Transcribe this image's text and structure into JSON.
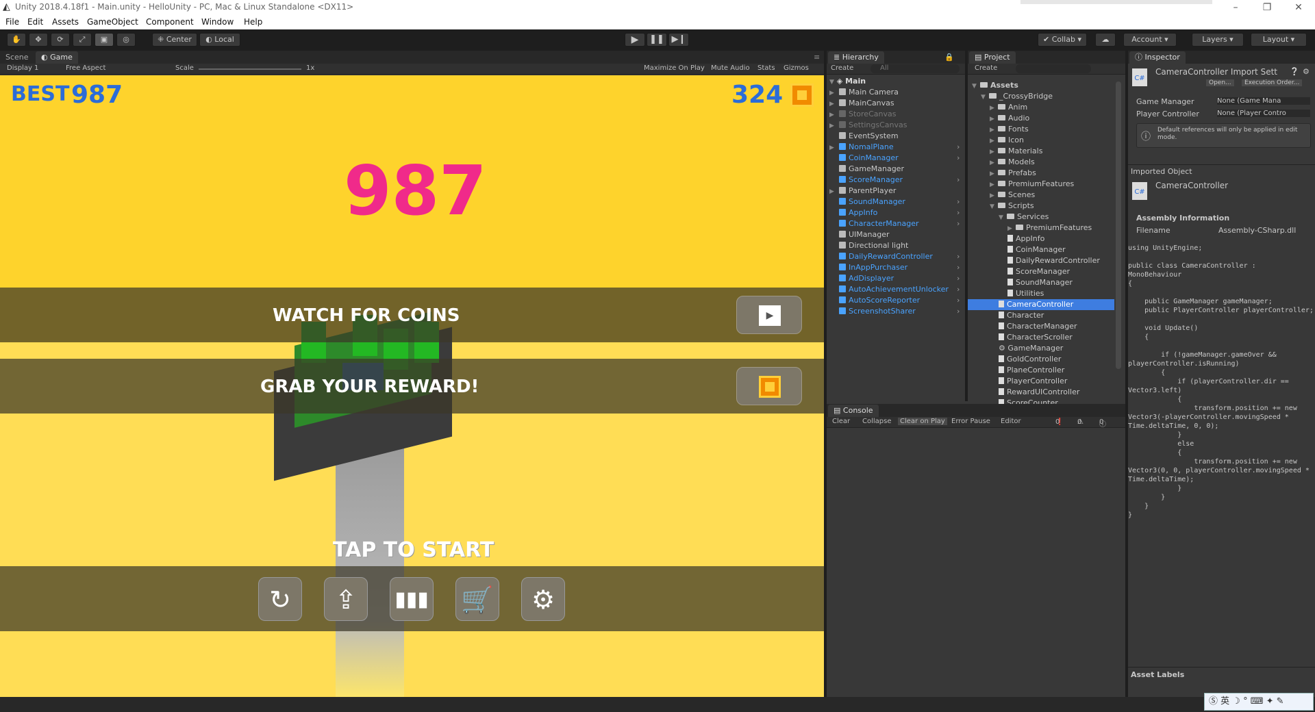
{
  "window": {
    "title": "Unity 2018.4.18f1 - Main.unity - HelloUnity - PC, Mac & Linux Standalone <DX11>",
    "minimize": "–",
    "maximize": "❐",
    "close": "✕"
  },
  "menu": [
    "File",
    "Edit",
    "Assets",
    "GameObject",
    "Component",
    "Window",
    "Help"
  ],
  "toolbar": {
    "center": "Center",
    "local": "Local",
    "collab": "Collab",
    "account": "Account",
    "layers": "Layers",
    "layout": "Layout"
  },
  "scene_tabs": {
    "scene": "Scene",
    "game": "Game"
  },
  "game_bar": {
    "display": "Display 1",
    "aspect": "Free Aspect",
    "scale": "Scale",
    "scale_val": "1x",
    "maximize": "Maximize On Play",
    "mute": "Mute Audio",
    "stats": "Stats",
    "gizmos": "Gizmos"
  },
  "game": {
    "best_label": "BEST",
    "best_value": "987",
    "coins": "324",
    "score": "987",
    "watch": "WATCH FOR COINS",
    "grab": "GRAB YOUR REWARD!",
    "tap": "TAP TO START"
  },
  "hierarchy": {
    "title": "Hierarchy",
    "create": "Create",
    "search": "All",
    "scene": "Main",
    "items": [
      {
        "name": "Main Camera",
        "color": "w",
        "arrow": true
      },
      {
        "name": "MainCanvas",
        "color": "w",
        "arrow": true
      },
      {
        "name": "StoreCanvas",
        "color": "d",
        "arrow": true
      },
      {
        "name": "SettingsCanvas",
        "color": "d",
        "arrow": true
      },
      {
        "name": "EventSystem",
        "color": "w",
        "arrow": false
      },
      {
        "name": "NomalPlane",
        "color": "b",
        "arrow": true
      },
      {
        "name": "CoinManager",
        "color": "b",
        "arrow": false
      },
      {
        "name": "GameManager",
        "color": "w",
        "arrow": false
      },
      {
        "name": "ScoreManager",
        "color": "b",
        "arrow": false
      },
      {
        "name": "ParentPlayer",
        "color": "w",
        "arrow": true
      },
      {
        "name": "SoundManager",
        "color": "b",
        "arrow": false
      },
      {
        "name": "AppInfo",
        "color": "b",
        "arrow": false
      },
      {
        "name": "CharacterManager",
        "color": "b",
        "arrow": false
      },
      {
        "name": "UIManager",
        "color": "w",
        "arrow": false
      },
      {
        "name": "Directional light",
        "color": "w",
        "arrow": false
      },
      {
        "name": "DailyRewardController",
        "color": "b",
        "arrow": false
      },
      {
        "name": "InAppPurchaser",
        "color": "b",
        "arrow": false
      },
      {
        "name": "AdDisplayer",
        "color": "b",
        "arrow": false
      },
      {
        "name": "AutoAchievementUnlocker",
        "color": "b",
        "arrow": false
      },
      {
        "name": "AutoScoreReporter",
        "color": "b",
        "arrow": false
      },
      {
        "name": "ScreenshotSharer",
        "color": "b",
        "arrow": false
      }
    ]
  },
  "project": {
    "title": "Project",
    "create": "Create",
    "items": [
      {
        "name": "Assets",
        "indent": 0,
        "type": "folder",
        "open": true,
        "bold": true
      },
      {
        "name": "_CrossyBridge",
        "indent": 1,
        "type": "folder",
        "open": true
      },
      {
        "name": "Anim",
        "indent": 2,
        "type": "folder"
      },
      {
        "name": "Audio",
        "indent": 2,
        "type": "folder"
      },
      {
        "name": "Fonts",
        "indent": 2,
        "type": "folder"
      },
      {
        "name": "Icon",
        "indent": 2,
        "type": "folder"
      },
      {
        "name": "Materials",
        "indent": 2,
        "type": "folder"
      },
      {
        "name": "Models",
        "indent": 2,
        "type": "folder"
      },
      {
        "name": "Prefabs",
        "indent": 2,
        "type": "folder"
      },
      {
        "name": "PremiumFeatures",
        "indent": 2,
        "type": "folder"
      },
      {
        "name": "Scenes",
        "indent": 2,
        "type": "folder"
      },
      {
        "name": "Scripts",
        "indent": 2,
        "type": "folder",
        "open": true
      },
      {
        "name": "Services",
        "indent": 3,
        "type": "folder",
        "open": true
      },
      {
        "name": "PremiumFeatures",
        "indent": 4,
        "type": "folder"
      },
      {
        "name": "AppInfo",
        "indent": 4,
        "type": "file"
      },
      {
        "name": "CoinManager",
        "indent": 4,
        "type": "file"
      },
      {
        "name": "DailyRewardController",
        "indent": 4,
        "type": "file"
      },
      {
        "name": "ScoreManager",
        "indent": 4,
        "type": "file"
      },
      {
        "name": "SoundManager",
        "indent": 4,
        "type": "file"
      },
      {
        "name": "Utilities",
        "indent": 4,
        "type": "file"
      },
      {
        "name": "CameraController",
        "indent": 3,
        "type": "file",
        "selected": true
      },
      {
        "name": "Character",
        "indent": 3,
        "type": "file"
      },
      {
        "name": "CharacterManager",
        "indent": 3,
        "type": "file"
      },
      {
        "name": "CharacterScroller",
        "indent": 3,
        "type": "file"
      },
      {
        "name": "GameManager",
        "indent": 3,
        "type": "gear"
      },
      {
        "name": "GoldController",
        "indent": 3,
        "type": "file"
      },
      {
        "name": "PlaneController",
        "indent": 3,
        "type": "file"
      },
      {
        "name": "PlayerController",
        "indent": 3,
        "type": "file"
      },
      {
        "name": "RewardUIController",
        "indent": 3,
        "type": "file"
      },
      {
        "name": "ScoreCounter",
        "indent": 3,
        "type": "file"
      }
    ]
  },
  "console": {
    "title": "Console",
    "clear": "Clear",
    "collapse": "Collapse",
    "clear_on_play": "Clear on Play",
    "error_pause": "Error Pause",
    "editor": "Editor",
    "c_err": "0",
    "c_warn": "0",
    "c_info": "0"
  },
  "inspector": {
    "title": "Inspector",
    "header": "CameraController Import Sett",
    "open": "Open...",
    "exec": "Execution Order...",
    "field1_label": "Game Manager",
    "field1_value": "None (Game Mana",
    "field2_label": "Player Controller",
    "field2_value": "None (Player Contro",
    "help": "Default references will only be applied in edit mode.",
    "imported": "Imported Object",
    "obj_name": "CameraController",
    "asm_title": "Assembly Information",
    "filename_label": "Filename",
    "filename_value": "Assembly-CSharp.dll",
    "code": "using UnityEngine;\n\npublic class CameraController :\nMonoBehaviour\n{\n\n    public GameManager gameManager;\n    public PlayerController playerController;\n\n    void Update()\n    {\n\n        if (!gameManager.gameOver &&\nplayerController.isRunning)\n        {\n            if (playerController.dir ==\nVector3.left)\n            {\n                transform.position += new\nVector3(-playerController.movingSpeed *\nTime.deltaTime, 0, 0);\n            }\n            else\n            {\n                transform.position += new\nVector3(0, 0, playerController.movingSpeed *\nTime.deltaTime);\n            }\n        }\n    }\n}",
    "asset_labels": "Asset Labels"
  },
  "ime": "英"
}
